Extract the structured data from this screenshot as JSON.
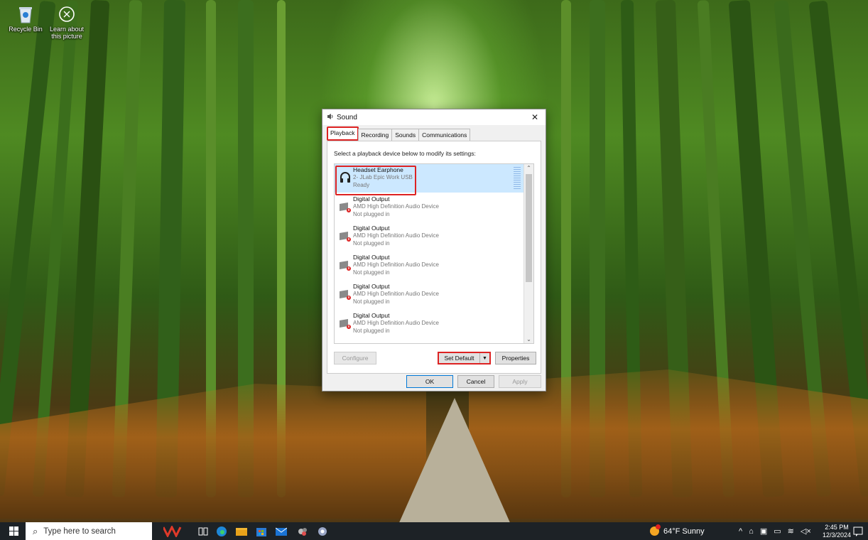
{
  "desktop": {
    "icons": [
      {
        "label": "Recycle Bin",
        "icon": "recycle-bin-icon"
      },
      {
        "label": "Learn about this picture",
        "icon": "camera-icon"
      }
    ]
  },
  "dialog": {
    "title": "Sound",
    "close": "✕",
    "tabs": [
      "Playback",
      "Recording",
      "Sounds",
      "Communications"
    ],
    "active_tab": "Playback",
    "instruction": "Select a playback device below to modify its settings:",
    "devices": [
      {
        "name": "Headset Earphone",
        "detail": "2- JLab Epic Work USB",
        "status": "Ready",
        "selected": true,
        "icon": "headset-icon"
      },
      {
        "name": "Digital Output",
        "detail": "AMD High Definition Audio Device",
        "status": "Not plugged in",
        "selected": false,
        "icon": "speaker-icon"
      },
      {
        "name": "Digital Output",
        "detail": "AMD High Definition Audio Device",
        "status": "Not plugged in",
        "selected": false,
        "icon": "speaker-icon"
      },
      {
        "name": "Digital Output",
        "detail": "AMD High Definition Audio Device",
        "status": "Not plugged in",
        "selected": false,
        "icon": "speaker-icon"
      },
      {
        "name": "Digital Output",
        "detail": "AMD High Definition Audio Device",
        "status": "Not plugged in",
        "selected": false,
        "icon": "speaker-icon"
      },
      {
        "name": "Digital Output",
        "detail": "AMD High Definition Audio Device",
        "status": "Not plugged in",
        "selected": false,
        "icon": "speaker-icon"
      }
    ],
    "buttons": {
      "configure": "Configure",
      "set_default": "Set Default",
      "properties": "Properties",
      "ok": "OK",
      "cancel": "Cancel",
      "apply": "Apply"
    }
  },
  "taskbar": {
    "search_placeholder": "Type here to search",
    "weather": "64°F Sunny",
    "time": "2:45 PM",
    "date": "12/3/2024"
  },
  "colors": {
    "highlight": "#dd2222",
    "selection": "#cce8ff",
    "taskbar": "#1d2226"
  }
}
